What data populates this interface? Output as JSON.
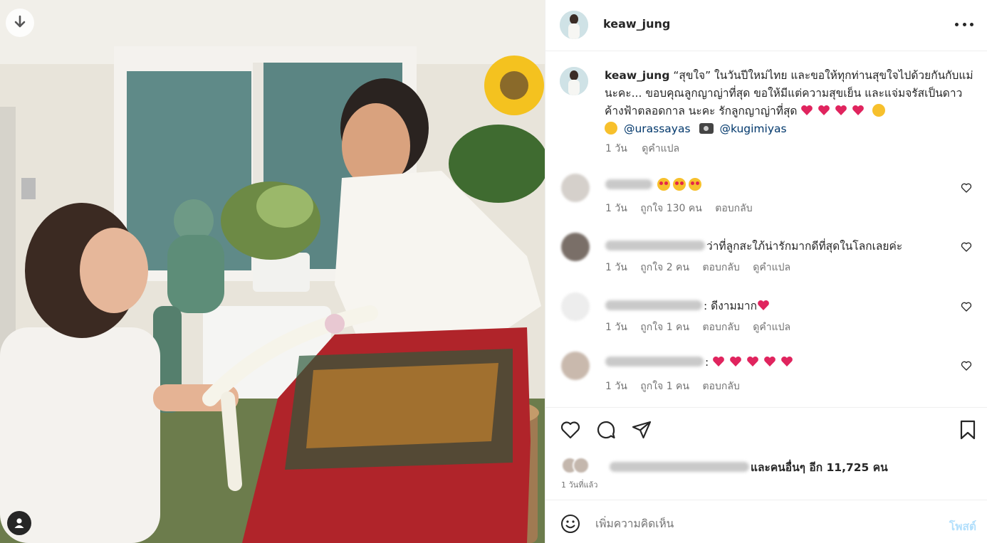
{
  "post": {
    "username": "keaw_jung",
    "caption": {
      "text_1": "“สุขใจ” ในวันปีใหม่ไทย และขอให้ทุกท่านสุขใจไปด้วยกันกับแม่นะคะ... ขอบคุณลูกญาญ่าที่สุด ขอให้มีแต่ความสุขเย็น และแจ่มจรัสเป็นดาวค้างฟ้าตลอดกาล นะคะ รักลูกญาญ่าที่สุด",
      "mention_1": "@urassayas",
      "mention_2": "@kugimiyas",
      "time": "1 วัน",
      "translate": "ดูคำแปล"
    },
    "comments": [
      {
        "text": "",
        "time": "1 วัน",
        "likes": "ถูกใจ 130 คน",
        "reply": "ตอบกลับ",
        "translate": ""
      },
      {
        "text": "ว่าที่ลูกสะใภ้น่ารักมากดีที่สุดในโลกเลยค่ะ",
        "time": "1 วัน",
        "likes": "ถูกใจ 2 คน",
        "reply": "ตอบกลับ",
        "translate": "ดูคำแปล"
      },
      {
        "text": ": ดีงามมาก",
        "time": "1 วัน",
        "likes": "ถูกใจ 1 คน",
        "reply": "ตอบกลับ",
        "translate": "ดูคำแปล"
      },
      {
        "text": ":",
        "time": "1 วัน",
        "likes": "ถูกใจ 1 คน",
        "reply": "ตอบกลับ",
        "translate": ""
      }
    ],
    "likes_text": "และคนอื่นๆ อีก 11,725 คน",
    "time_ago": "1 วันที่แล้ว",
    "add_comment": {
      "placeholder": "เพิ่มความคิดเห็น",
      "post_label": "โพสต์"
    }
  },
  "icons": {
    "download": "download-icon",
    "user_tag": "user-tag-icon",
    "more": "more-icon",
    "like": "heart-icon",
    "comment": "comment-icon",
    "share": "share-icon",
    "save": "bookmark-icon",
    "emoji": "emoji-icon"
  },
  "colors": {
    "text": "#262626",
    "secondary": "#737373",
    "link": "#00376b",
    "post_button_disabled": "#b2dffc",
    "heart_emoji": "#e0245e"
  }
}
